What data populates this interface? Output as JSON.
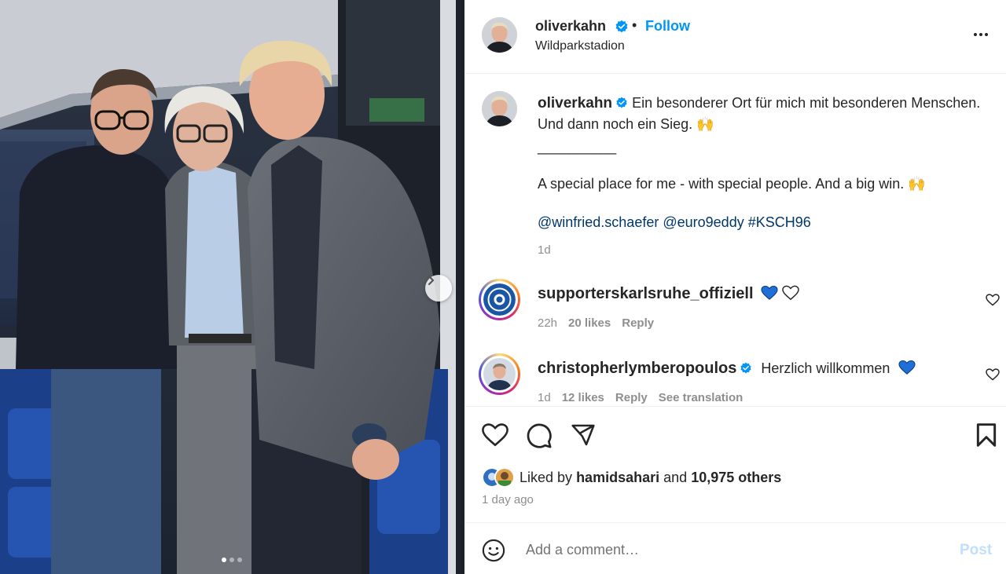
{
  "header": {
    "username": "oliverkahn",
    "dot": "•",
    "follow_label": "Follow",
    "location": "Wildparkstadion"
  },
  "caption": {
    "username": "oliverkahn",
    "text_de": "Ein besonderer Ort für mich mit besonderen Menschen. Und dann noch ein Sieg.",
    "emoji": "🙌",
    "separator": "__________",
    "text_en": "A special place for me - with special people. And a big win.",
    "mentions": [
      "@winfried.schaefer",
      "@euro9eddy",
      "#KSCH96"
    ],
    "age": "1d"
  },
  "comments": [
    {
      "username": "supporterskarlsruhe_offiziell",
      "text": "",
      "time": "22h",
      "likes": "20 likes",
      "reply": "Reply",
      "translation": ""
    },
    {
      "username": "christopherlymberopoulos",
      "text": "Herzlich willkommen",
      "time": "1d",
      "likes": "12 likes",
      "reply": "Reply",
      "translation": "See translation"
    }
  ],
  "likes": {
    "prefix": "Liked by",
    "user": "hamidsahari",
    "and": "and",
    "others": "10,975 others"
  },
  "posted": "1 day ago",
  "comment_box": {
    "placeholder": "Add a comment…",
    "post_label": "Post"
  },
  "icons": {
    "verified": "verified-badge-icon",
    "more": "more-options-icon",
    "next": "chevron-right-icon",
    "heart": "heart-icon",
    "comment": "comment-icon",
    "share": "share-icon",
    "save": "bookmark-icon",
    "emoji": "emoji-icon"
  },
  "colors": {
    "accent": "#0095f6",
    "link": "#00376b",
    "verified": "#0095f6",
    "heart_blue": "#1f6fd6",
    "muted": "#8e8e8e",
    "post_disabled": "#c0dffd"
  },
  "carousel": {
    "slides": 3,
    "active": 1
  }
}
